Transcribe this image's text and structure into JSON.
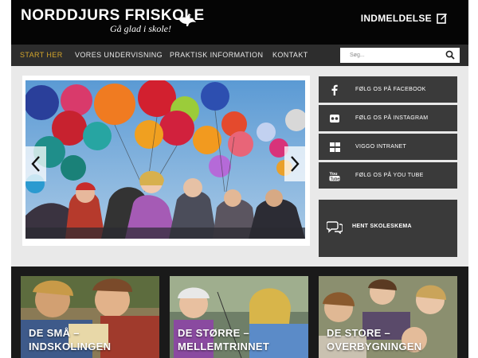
{
  "header": {
    "logo_title": "NORDDJURS FRISKOLE",
    "logo_tagline": "Gå glad i skole!",
    "logo_icon": "bird-icon",
    "signup_label": "INDMELDELSE",
    "signup_icon": "edit-icon"
  },
  "nav": {
    "items": [
      {
        "label": "START HER",
        "active": true
      },
      {
        "label": "VORES UNDERVISNING",
        "active": false
      },
      {
        "label": "PRAKTISK INFORMATION",
        "active": false
      },
      {
        "label": "KONTAKT",
        "active": false
      }
    ],
    "search_placeholder": "Søg...",
    "accent_color": "#d4a52b"
  },
  "slider": {
    "prev_icon": "chevron-left-icon",
    "next_icon": "chevron-right-icon"
  },
  "sidebar": {
    "links": [
      {
        "label": "FØLG OS PÅ FACEBOOK",
        "icon": "facebook-icon"
      },
      {
        "label": "FØLG OS PÅ INSTAGRAM",
        "icon": "instagram-icon"
      },
      {
        "label": "VIGGO INTRANET",
        "icon": "grid-icon"
      },
      {
        "label": "FØLG OS PÅ YOU TUBE",
        "icon": "youtube-icon"
      }
    ],
    "schedule_label": "HENT SKOLESKEMA",
    "schedule_icon": "chat-icon"
  },
  "cards": [
    {
      "line1": "DE SMÅ –",
      "line2": "INDSKOLINGEN"
    },
    {
      "line1": "DE STØRRE –",
      "line2": "MELLEMTRINNET"
    },
    {
      "line1": "DE STORE –",
      "line2": "OVERBYGNINGEN"
    }
  ]
}
